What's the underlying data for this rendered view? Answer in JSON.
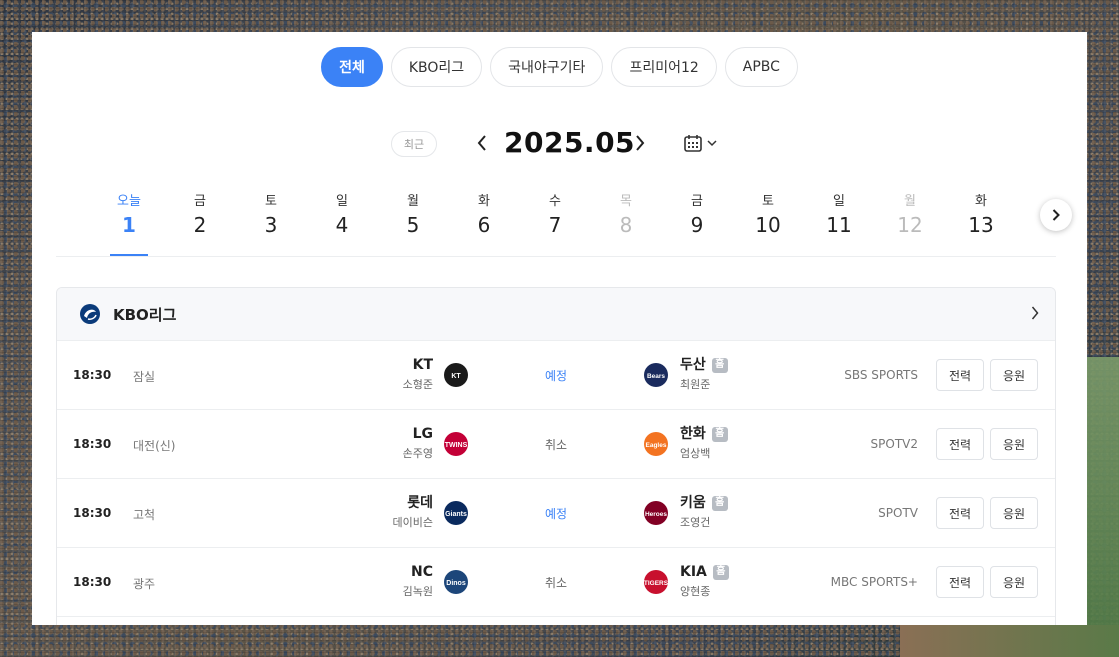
{
  "tabs": [
    {
      "label": "전체",
      "active": true
    },
    {
      "label": "KBO리그",
      "active": false
    },
    {
      "label": "국내야구기타",
      "active": false
    },
    {
      "label": "프리미어12",
      "active": false
    },
    {
      "label": "APBC",
      "active": false
    }
  ],
  "nav": {
    "recent_label": "최근",
    "month": "2025.05",
    "prev_icon": "chevron-left-icon",
    "next_icon": "chevron-right-icon",
    "calendar_icon": "calendar-icon"
  },
  "days": [
    {
      "dow": "오늘",
      "num": "1",
      "state": "today"
    },
    {
      "dow": "금",
      "num": "2",
      "state": "normal"
    },
    {
      "dow": "토",
      "num": "3",
      "state": "normal"
    },
    {
      "dow": "일",
      "num": "4",
      "state": "normal"
    },
    {
      "dow": "월",
      "num": "5",
      "state": "normal"
    },
    {
      "dow": "화",
      "num": "6",
      "state": "normal"
    },
    {
      "dow": "수",
      "num": "7",
      "state": "normal"
    },
    {
      "dow": "목",
      "num": "8",
      "state": "off"
    },
    {
      "dow": "금",
      "num": "9",
      "state": "normal"
    },
    {
      "dow": "토",
      "num": "10",
      "state": "normal"
    },
    {
      "dow": "일",
      "num": "11",
      "state": "normal"
    },
    {
      "dow": "월",
      "num": "12",
      "state": "off"
    },
    {
      "dow": "화",
      "num": "13",
      "state": "normal"
    }
  ],
  "league": {
    "title": "KBO리그",
    "home_badge": "홈",
    "stats_label": "전력",
    "cheer_label": "응원",
    "games": [
      {
        "time": "18:30",
        "stadium": "잠실",
        "away": "KT",
        "away_pitcher": "소형준",
        "status": "예정",
        "status_type": "sched",
        "home": "두산",
        "home_pitcher": "최원준",
        "broadcast": "SBS SPORTS",
        "away_color": "#1a1a1a",
        "home_color": "#1a2b5e",
        "away_logo_text": "KT",
        "home_logo_text": "Bears"
      },
      {
        "time": "18:30",
        "stadium": "대전(신)",
        "away": "LG",
        "away_pitcher": "손주영",
        "status": "취소",
        "status_type": "cancel",
        "home": "한화",
        "home_pitcher": "엄상백",
        "broadcast": "SPOTV2",
        "away_color": "#c30037",
        "home_color": "#f37321",
        "away_logo_text": "TWINS",
        "home_logo_text": "Eagles"
      },
      {
        "time": "18:30",
        "stadium": "고척",
        "away": "롯데",
        "away_pitcher": "데이비슨",
        "status": "예정",
        "status_type": "sched",
        "home": "키움",
        "home_pitcher": "조영건",
        "broadcast": "SPOTV",
        "away_color": "#0a2a5e",
        "home_color": "#820024",
        "away_logo_text": "Giants",
        "home_logo_text": "Heroes"
      },
      {
        "time": "18:30",
        "stadium": "광주",
        "away": "NC",
        "away_pitcher": "김녹원",
        "status": "취소",
        "status_type": "cancel",
        "home": "KIA",
        "home_pitcher": "양현종",
        "broadcast": "MBC SPORTS+",
        "away_color": "#1d467a",
        "home_color": "#c8102e",
        "away_logo_text": "Dinos",
        "home_logo_text": "TIGERS"
      }
    ]
  },
  "colors": {
    "accent": "#3b82f6",
    "home_badge": "#b7bcc3"
  }
}
